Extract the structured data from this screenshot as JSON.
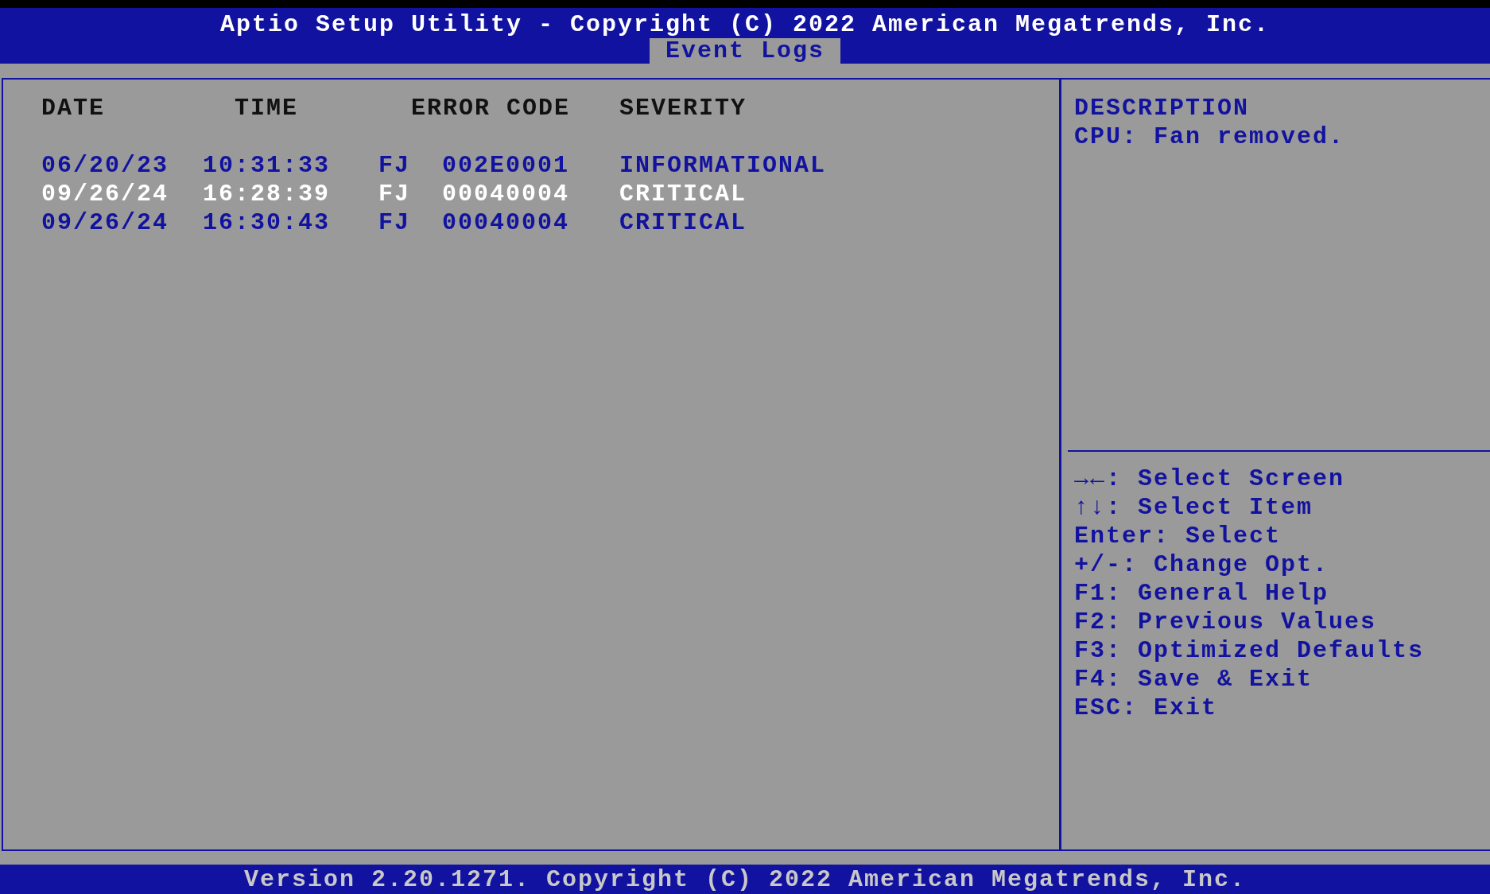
{
  "window": {
    "title": "Aptio Setup Utility - Copyright (C) 2022 American Megatrends, Inc."
  },
  "tabs": [
    {
      "label": "Event Logs",
      "selected": true
    }
  ],
  "table": {
    "columns": [
      "DATE",
      "TIME",
      "ERROR CODE",
      "SEVERITY"
    ],
    "rows": [
      {
        "date": "06/20/23",
        "time": "10:31:33",
        "source": "FJ",
        "error_code": "002E0001",
        "severity": "INFORMATIONAL",
        "selected": false
      },
      {
        "date": "09/26/24",
        "time": "16:28:39",
        "source": "FJ",
        "error_code": "00040004",
        "severity": "CRITICAL",
        "selected": true
      },
      {
        "date": "09/26/24",
        "time": "16:30:43",
        "source": "FJ",
        "error_code": "00040004",
        "severity": "CRITICAL",
        "selected": false
      }
    ]
  },
  "description": {
    "heading": "DESCRIPTION",
    "text": "CPU: Fan removed."
  },
  "help": [
    "→←: Select Screen",
    "↑↓: Select Item",
    "Enter: Select",
    "+/-: Change Opt.",
    "F1: General Help",
    "F2: Previous Values",
    "F3: Optimized Defaults",
    "F4: Save & Exit",
    "ESC: Exit"
  ],
  "status_bar": "Version 2.20.1271. Copyright (C) 2022 American Megatrends, Inc."
}
